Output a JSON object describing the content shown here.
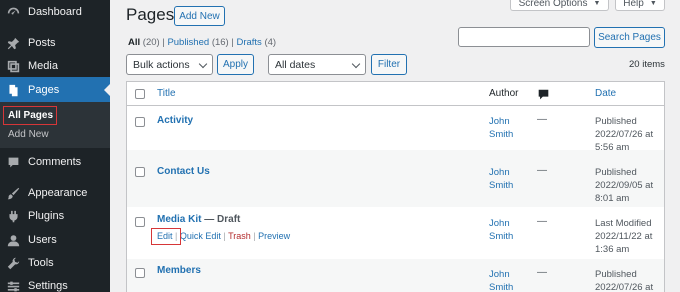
{
  "sidebar": {
    "items": [
      {
        "label": "Dashboard",
        "icon": "dashboard-icon"
      },
      {
        "label": "Posts",
        "icon": "pin-icon"
      },
      {
        "label": "Media",
        "icon": "media-icon"
      },
      {
        "label": "Pages",
        "icon": "pages-icon"
      },
      {
        "label": "Comments",
        "icon": "comment-icon"
      },
      {
        "label": "Appearance",
        "icon": "brush-icon"
      },
      {
        "label": "Plugins",
        "icon": "plugin-icon"
      },
      {
        "label": "Users",
        "icon": "users-icon"
      },
      {
        "label": "Tools",
        "icon": "wrench-icon"
      },
      {
        "label": "Settings",
        "icon": "settings-icon"
      }
    ],
    "submenu": [
      {
        "label": "All Pages"
      },
      {
        "label": "Add New"
      }
    ]
  },
  "header": {
    "title": "Pages",
    "add_new": "Add New",
    "screen_options": "Screen Options",
    "help": "Help"
  },
  "filters": {
    "all_label": "All",
    "all_count": "(20)",
    "published_label": "Published",
    "published_count": "(16)",
    "drafts_label": "Drafts",
    "drafts_count": "(4)",
    "sep": "|"
  },
  "search": {
    "button": "Search Pages",
    "value": ""
  },
  "toolbar": {
    "bulk_actions": "Bulk actions",
    "apply": "Apply",
    "dates": "All dates",
    "filter": "Filter",
    "items_count": "20 items"
  },
  "table": {
    "columns": {
      "title": "Title",
      "author": "Author",
      "date": "Date"
    },
    "rows": [
      {
        "title": "Activity",
        "state": "",
        "author_first": "John",
        "author_last": "Smith",
        "comments": "—",
        "date_status": "Published",
        "date": "2022/07/26 at",
        "time": "5:56 am"
      },
      {
        "title": "Contact Us",
        "state": "",
        "author_first": "John",
        "author_last": "Smith",
        "comments": "—",
        "date_status": "Published",
        "date": "2022/09/05 at",
        "time": "8:01 am"
      },
      {
        "title": "Media Kit",
        "state": "— Draft",
        "author_first": "John",
        "author_last": "Smith",
        "comments": "—",
        "date_status": "Last Modified",
        "date": "2022/11/22 at",
        "time": "1:36 am",
        "actions": {
          "edit": "Edit",
          "quick_edit": "Quick Edit",
          "trash": "Trash",
          "preview": "Preview",
          "sep": "|"
        }
      },
      {
        "title": "Members",
        "state": "",
        "author_first": "John",
        "author_last": "Smith",
        "comments": "—",
        "date_status": "Published",
        "date": "2022/07/26 at",
        "time": ""
      }
    ]
  },
  "colors": {
    "accent": "#2271b1",
    "sidebar": "#1d2327",
    "highlight": "#d63638",
    "trash": "#b32d2e"
  }
}
